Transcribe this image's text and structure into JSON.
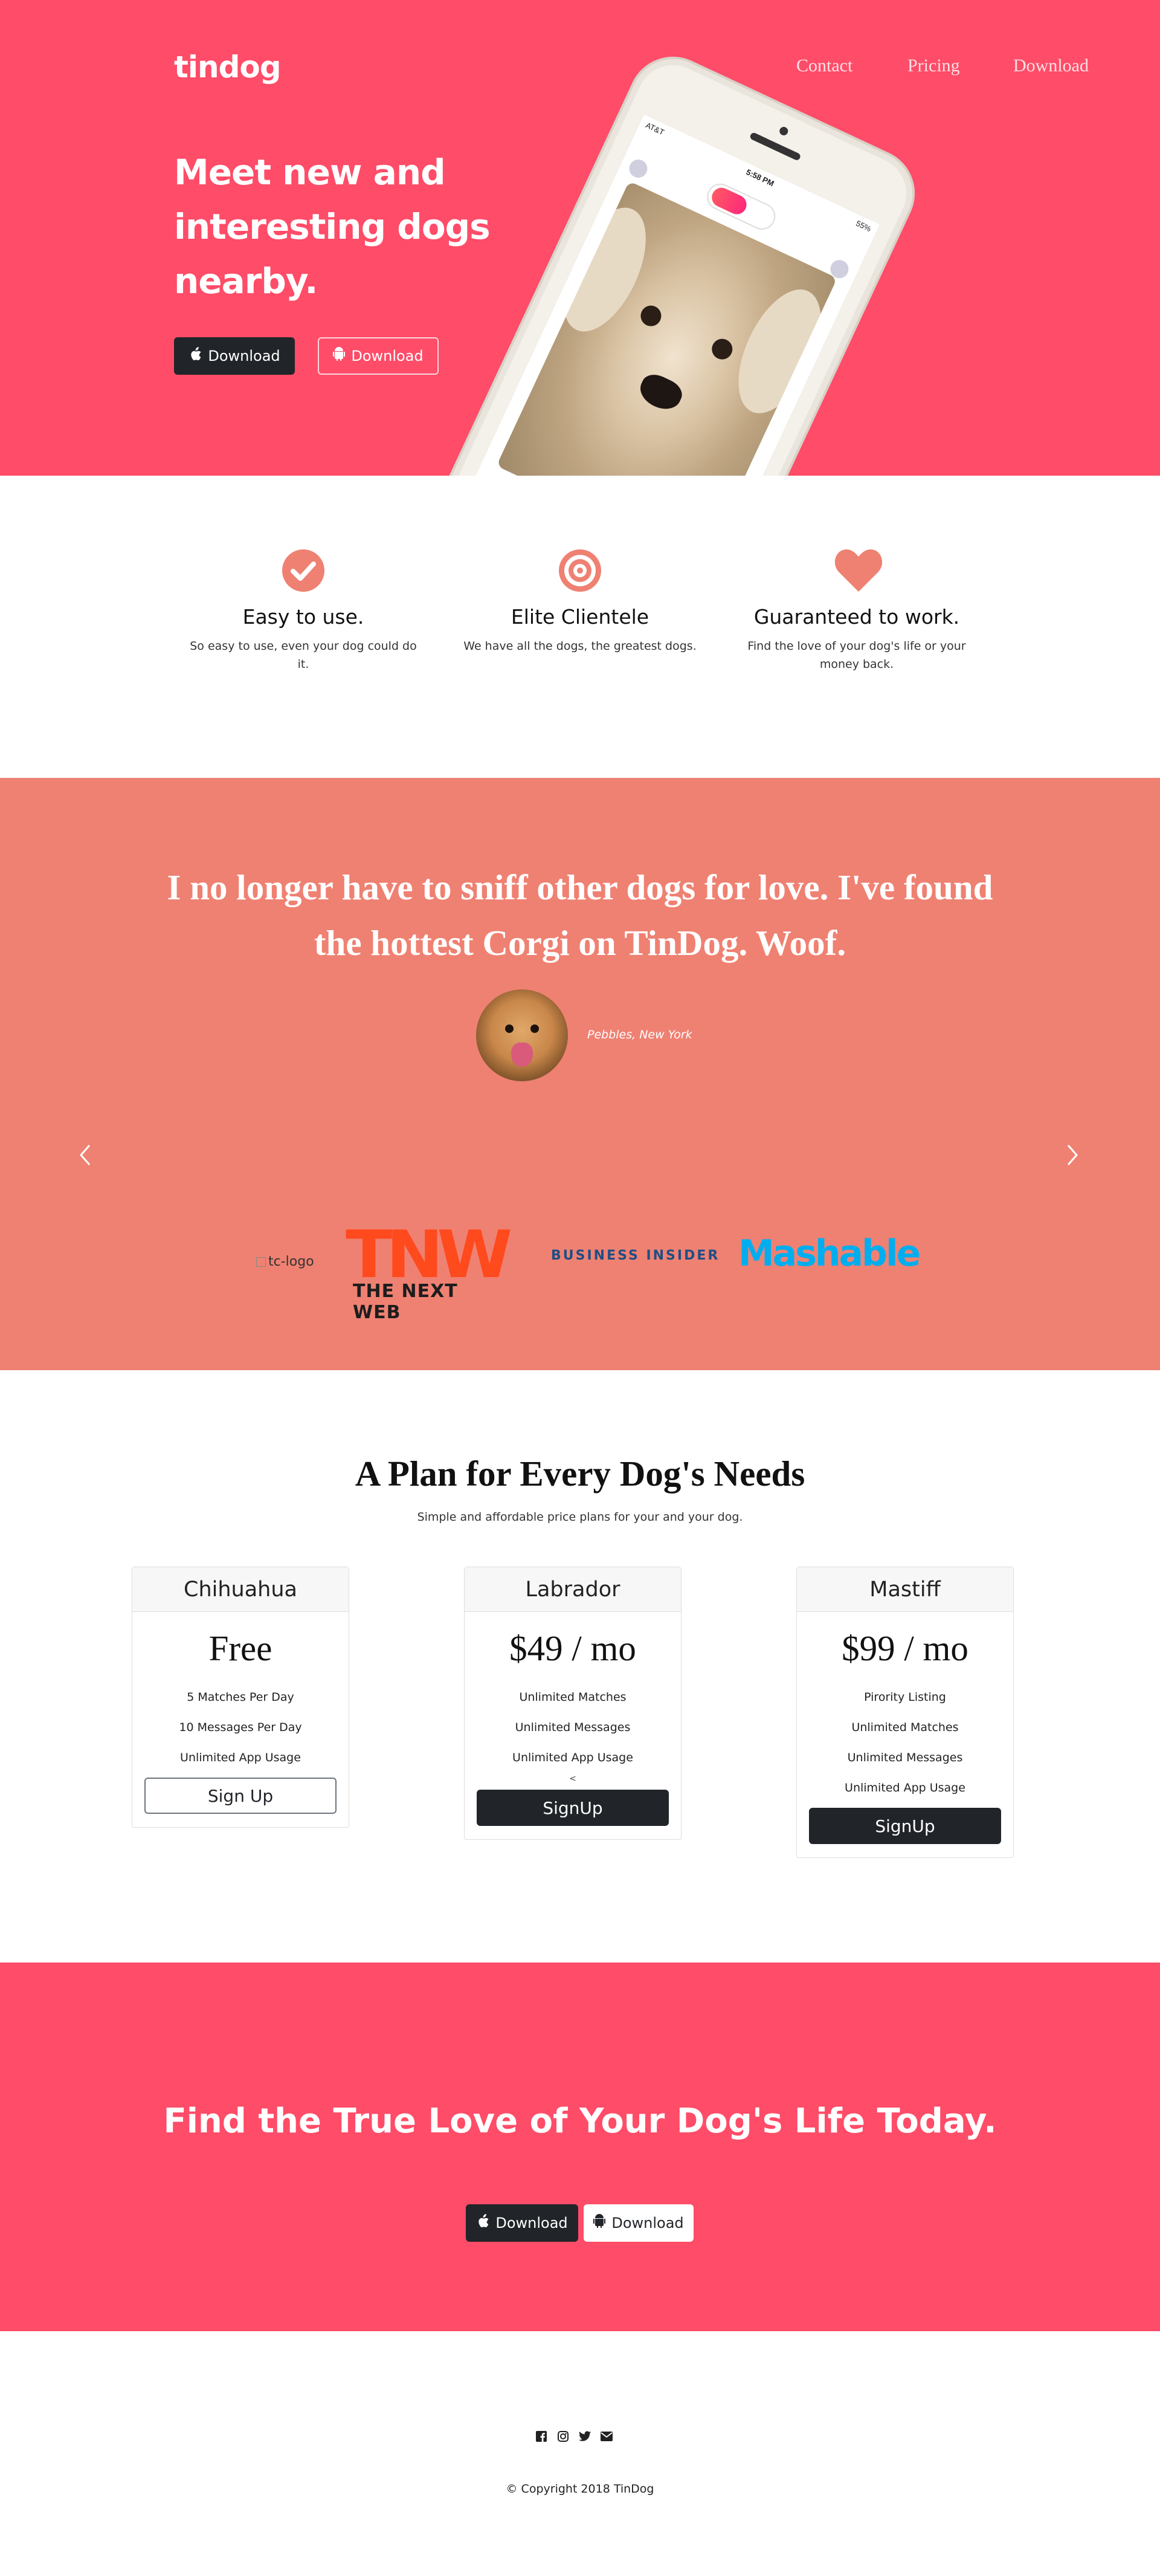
{
  "brand": {
    "name": "tindog",
    "accent": "#ff4c68",
    "testimonial_bg": "#ef8172"
  },
  "nav": {
    "links": [
      "Contact",
      "Pricing",
      "Download"
    ]
  },
  "hero": {
    "title": "Meet new and interesting dogs nearby.",
    "buttons": [
      {
        "label": "Download",
        "icon": "apple-icon"
      },
      {
        "label": "Download",
        "icon": "android-icon"
      }
    ],
    "phone": {
      "carrier": "AT&T",
      "time": "5:58 PM",
      "battery": "55%"
    }
  },
  "features": [
    {
      "icon": "check-circle-icon",
      "title": "Easy to use.",
      "text": "So easy to use, even your dog could do it."
    },
    {
      "icon": "bullseye-icon",
      "title": "Elite Clientele",
      "text": "We have all the dogs, the greatest dogs."
    },
    {
      "icon": "heart-icon",
      "title": "Guaranteed to work.",
      "text": "Find the love of your dog's life or your money back."
    }
  ],
  "testimonial": {
    "quote": "I no longer have to sniff other dogs for love. I've found the hottest Corgi on TinDog. Woof.",
    "author": "Pebbles, New York",
    "prev_icon": "chevron-left-icon",
    "next_icon": "chevron-right-icon"
  },
  "press": {
    "broken_logo_alt": "tc-logo",
    "tnw_mark": "TNW",
    "tnw_name": "THE NEXT WEB",
    "business_insider": "BUSINESS INSIDER",
    "mashable": "Mashable"
  },
  "pricing": {
    "heading": "A Plan for Every Dog's Needs",
    "subheading": "Simple and affordable price plans for your and your dog.",
    "plans": [
      {
        "name": "Chihuahua",
        "price": "Free",
        "features": [
          "5 Matches Per Day",
          "10 Messages Per Day",
          "Unlimited App Usage"
        ],
        "button": "Sign Up"
      },
      {
        "name": "Labrador",
        "price": "$49 / mo",
        "features": [
          "Unlimited Matches",
          "Unlimited Messages",
          "Unlimited App Usage"
        ],
        "extra": "<",
        "button": "SignUp"
      },
      {
        "name": "Mastiff",
        "price": "$99 / mo",
        "features": [
          "Pirority Listing",
          "Unlimited Matches",
          "Unlimited Messages",
          "Unlimited App Usage"
        ],
        "button": "SignUp"
      }
    ]
  },
  "cta": {
    "heading": "Find the True Love of Your Dog's Life Today.",
    "buttons": [
      {
        "label": "Download",
        "icon": "apple-icon"
      },
      {
        "label": "Download",
        "icon": "android-icon"
      }
    ]
  },
  "footer": {
    "social_icons": [
      "facebook-icon",
      "instagram-icon",
      "twitter-icon",
      "envelope-icon"
    ],
    "copyright": "© Copyright 2018 TinDog"
  }
}
